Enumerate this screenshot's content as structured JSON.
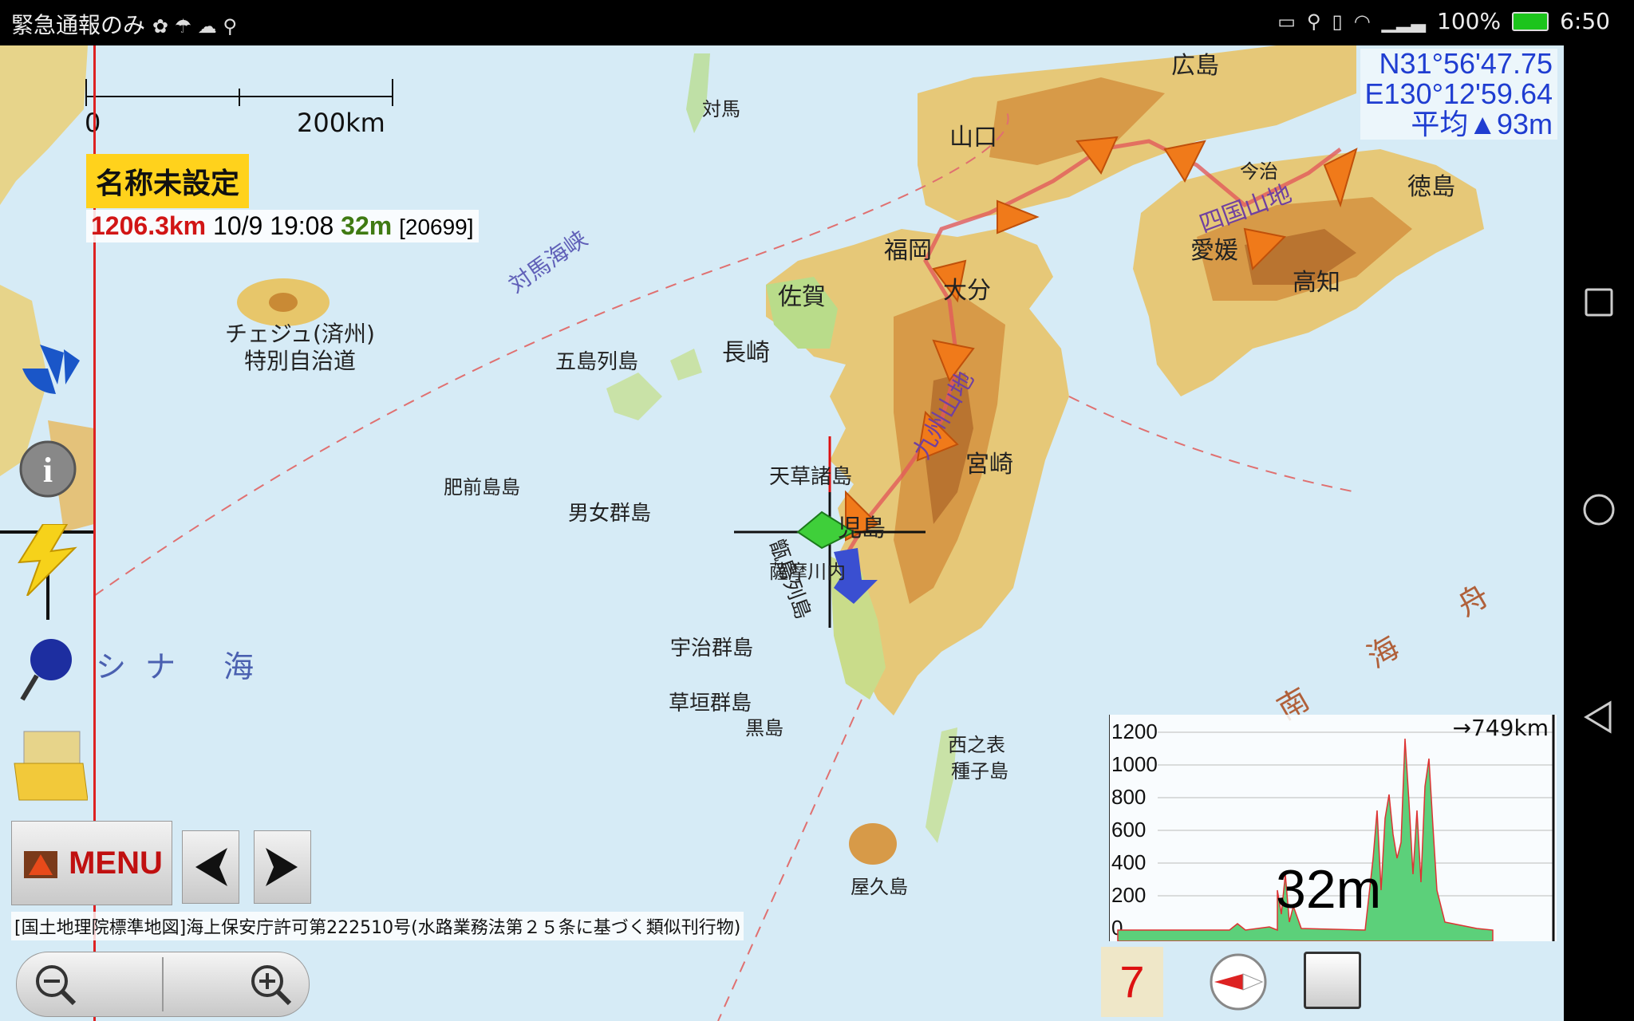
{
  "status_bar": {
    "carrier": "緊急通報のみ",
    "battery": "100%",
    "time": "6:50"
  },
  "map": {
    "scale_start": "0",
    "scale_end": "200km",
    "coord_lat": "N31°56'47.75",
    "coord_lon": "E130°12'59.64",
    "coord_alt": "平均▲93m",
    "labels": {
      "jeju_en": "チェジュ(済州)",
      "jeju_special": "特別自治道",
      "goto": "五島列島",
      "danjo": "男女群島",
      "uji": "宇治群島",
      "kusagaki": "草垣群島",
      "tsushima": "対馬",
      "nagasaki": "長崎",
      "saga": "佐賀",
      "fukuoka": "福岡",
      "oita": "大分",
      "miyazaki": "宮崎",
      "kagoshima_jp": "児島",
      "yamaguchi": "山口",
      "hiroshima": "広島",
      "ehime": "愛媛",
      "kochi": "高知",
      "tokushima": "徳島",
      "shikoku_mtn": "四国山地",
      "kyushu_mtn": "九州山地",
      "tsushima_strait": "対馬海峡",
      "east_china_sea": "シナ 海",
      "south_sea": "南 海 舟",
      "yakushima": "屋久島",
      "tanegashima": "種子島",
      "hizen": "肥前島島",
      "kuroshima": "黒島",
      "amakusa": "天草諸島",
      "satsuma": "薩摩川内",
      "nishinoomote": "西之表",
      "shikoku_city": "今治",
      "koshiki": "甑島列島"
    },
    "copyright": "[国土地理院標準地図]海上保安庁許可第222510号(水路業務法第２５条に基づく類似刊行物)"
  },
  "track": {
    "name": "名称未設定",
    "distance": "1206.3km",
    "datetime": "10/9 19:08",
    "altitude": "32m",
    "count": "[20699]"
  },
  "controls": {
    "menu_label": "MENU",
    "page_number": "7"
  },
  "elevation": {
    "ticks": [
      "1200",
      "1000",
      "800",
      "600",
      "400",
      "200",
      "0"
    ],
    "distance_label": "→749km",
    "current_altitude": "32m"
  }
}
